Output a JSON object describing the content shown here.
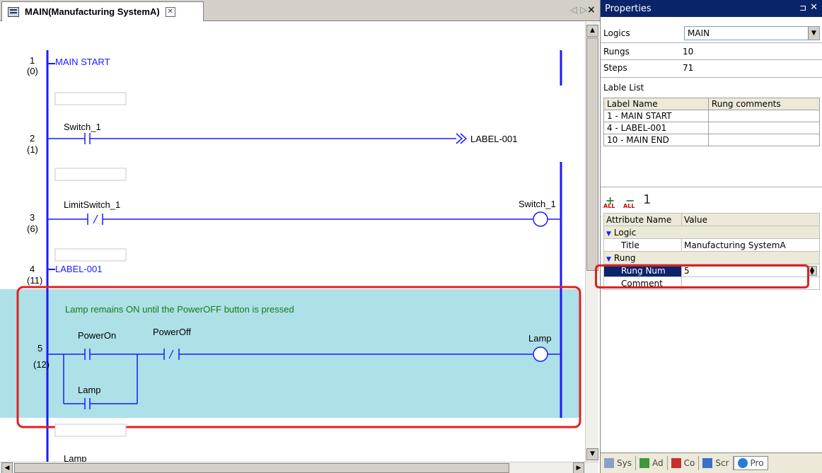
{
  "editor": {
    "tab_title": "MAIN(Manufacturing SystemA)",
    "tab_close": "✕",
    "nav_arrows": "◁ ▷",
    "close_all": "×"
  },
  "ladder": {
    "rungs": [
      {
        "number": "1",
        "step": "(0)",
        "label": "MAIN START"
      },
      {
        "number": "2",
        "step": "(1)",
        "contact": "Switch_1",
        "jump_target": "LABEL-001"
      },
      {
        "number": "3",
        "step": "(6)",
        "contact": "LimitSwitch_1",
        "coil": "Switch_1"
      },
      {
        "number": "4",
        "step": "(11)",
        "label": "LABEL-001"
      },
      {
        "number": "5",
        "step": "(12)",
        "comment": "Lamp remains ON until the PowerOFF button is pressed",
        "contact_a": "PowerOn",
        "contact_b": "PowerOff",
        "contact_parallel": "Lamp",
        "coil": "Lamp"
      },
      {
        "partial_label": "Lamp"
      }
    ]
  },
  "properties": {
    "title": "Properties",
    "pin": "⊐",
    "close": "✕",
    "logics_label": "Logics",
    "logics_value": "MAIN",
    "rungs_label": "Rungs",
    "rungs_value": "10",
    "steps_label": "Steps",
    "steps_value": "71",
    "label_list_title": "Lable List",
    "label_list_headers": [
      "Label Name",
      "Rung comments"
    ],
    "label_list_rows": [
      [
        "1 - MAIN START",
        ""
      ],
      [
        "4 - LABEL-001",
        ""
      ],
      [
        "10 - MAIN END",
        ""
      ]
    ],
    "toolbar": {
      "expand_all": "ALL",
      "collapse_all": "ALL",
      "one": "1"
    },
    "attr_headers": [
      "Attribute Name",
      "Value"
    ],
    "logic_category": "Logic",
    "title_attr": "Title",
    "title_value": "Manufacturing SystemA",
    "rung_category": "Rung",
    "rung_num_attr": "Rung Num",
    "rung_num_value": "5",
    "comment_attr": "Comment",
    "comment_value": ""
  },
  "bottom_tabs": [
    "Sys",
    "Ad",
    "Co",
    "Scr",
    "Pro"
  ]
}
